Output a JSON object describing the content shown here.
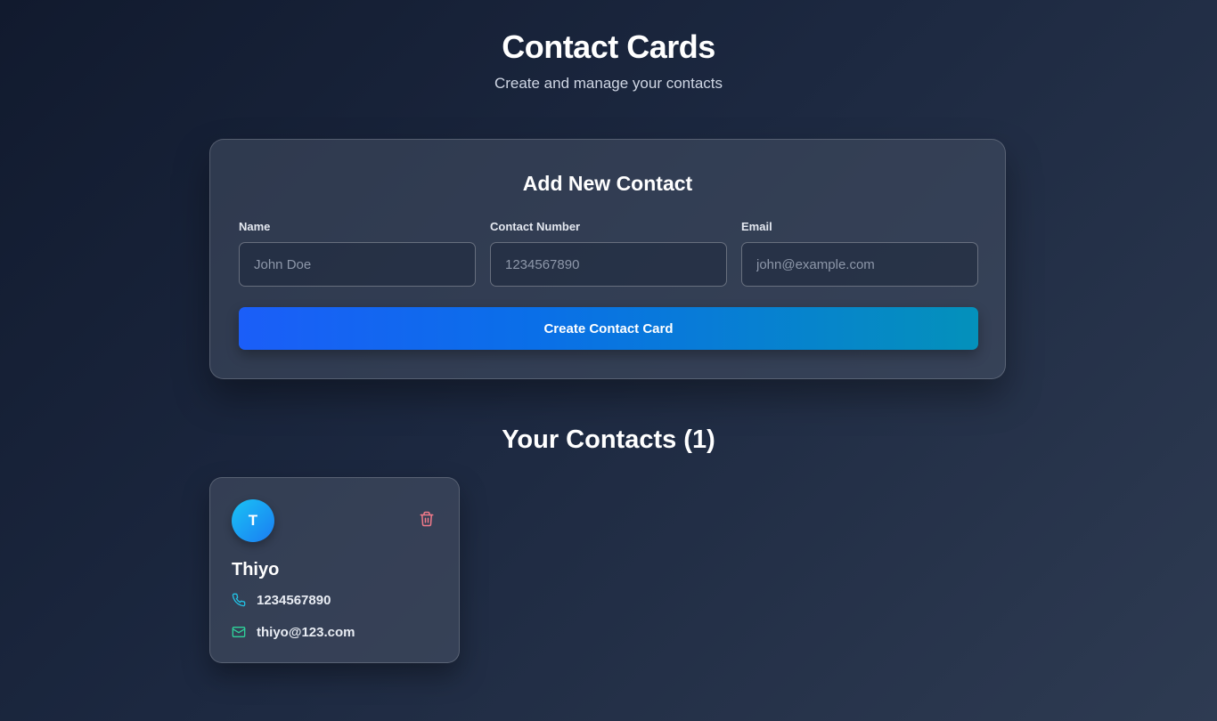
{
  "header": {
    "title": "Contact Cards",
    "subtitle": "Create and manage your contacts"
  },
  "form": {
    "title": "Add New Contact",
    "fields": [
      {
        "label": "Name",
        "placeholder": "John Doe",
        "value": ""
      },
      {
        "label": "Contact Number",
        "placeholder": "1234567890",
        "value": ""
      },
      {
        "label": "Email",
        "placeholder": "john@example.com",
        "value": ""
      }
    ],
    "submit_label": "Create Contact Card"
  },
  "contacts": {
    "heading": "Your Contacts (1)",
    "items": [
      {
        "initial": "T",
        "name": "Thiyo",
        "phone": "1234567890",
        "email": "thiyo@123.com",
        "phone_icon": "phone-icon",
        "email_icon": "mail-icon",
        "delete_icon": "trash-icon"
      }
    ]
  },
  "colors": {
    "accent_start": "#1b5ef8",
    "accent_end": "#0491bb",
    "phone_icon": "#22c3e6",
    "email_icon": "#2fd39b",
    "delete_icon": "#f27a8a"
  }
}
